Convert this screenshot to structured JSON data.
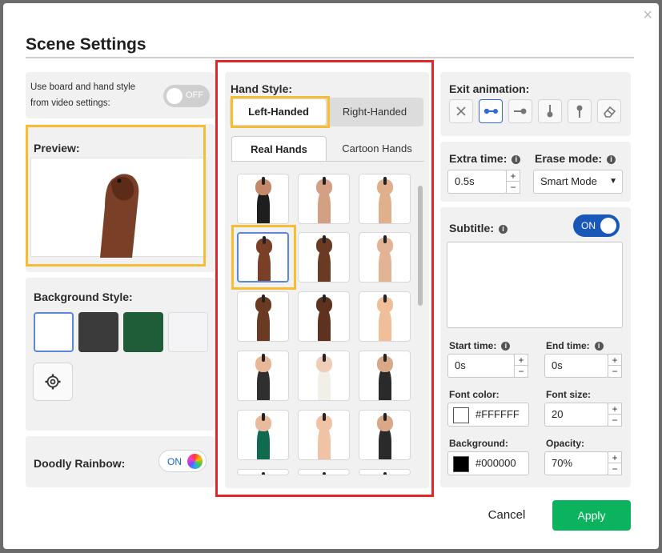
{
  "dialog": {
    "title": "Scene Settings",
    "close_glyph": "×"
  },
  "left": {
    "use_board_label_1": "Use board and hand style",
    "use_board_label_2": "from video settings:",
    "use_board_toggle": "OFF",
    "preview_label": "Preview:",
    "background_label": "Background Style:",
    "backgrounds": [
      "white",
      "dark-slate",
      "green-chalk",
      "light-grey"
    ],
    "rainbow_label": "Doodly Rainbow:",
    "rainbow_toggle": "ON"
  },
  "hands": {
    "label": "Hand Style:",
    "handedness": [
      "Left-Handed",
      "Right-Handed"
    ],
    "tabs": [
      "Real Hands",
      "Cartoon Hands"
    ]
  },
  "right": {
    "exit_label": "Exit animation:",
    "exit_icons": [
      "close-icon",
      "dot-line-left-icon",
      "dot-line-right-icon",
      "dot-line-up-icon",
      "dot-line-down-icon",
      "eraser-icon"
    ],
    "extra_time_label": "Extra time:",
    "extra_time_value": "0.5s",
    "erase_label": "Erase mode:",
    "erase_value": "Smart Mode",
    "subtitle_label": "Subtitle:",
    "subtitle_toggle": "ON",
    "start_label": "Start time:",
    "start_value": "0s",
    "end_label": "End time:",
    "end_value": "0s",
    "font_color_label": "Font color:",
    "font_color_value": "#FFFFFF",
    "font_size_label": "Font size:",
    "font_size_value": "20",
    "bg_label": "Background:",
    "bg_value": "#000000",
    "opacity_label": "Opacity:",
    "opacity_value": "70%",
    "plus": "+",
    "minus": "−",
    "caret": "▼"
  },
  "footer": {
    "cancel": "Cancel",
    "apply": "Apply"
  },
  "colors": {
    "primary": "#1957b8",
    "apply": "#0cb35e",
    "highlight": "#f6bd34",
    "frame": "#e4262b"
  }
}
